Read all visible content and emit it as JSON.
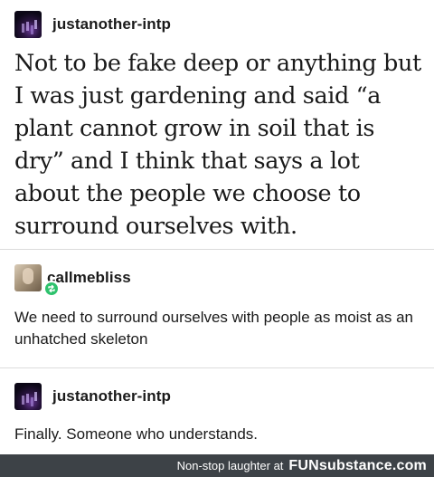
{
  "posts": [
    {
      "username": "justanother-intp",
      "text": "Not to be fake deep or anything but I was just gardening and said “a plant cannot grow in soil that is dry” and I think that says a lot about the people we choose to surround ourselves with."
    },
    {
      "username": "callmebliss",
      "text": "We need to surround ourselves with people as moist as an unhatched skeleton"
    },
    {
      "username": "justanother-intp",
      "text": "Finally. Someone who understands."
    }
  ],
  "footer": {
    "tagline": "Non-stop laughter at",
    "logo": "FUNsubstance.com"
  },
  "colors": {
    "reblog_badge": "#2ec26d",
    "footer_bg": "#3d4247"
  },
  "icons": {
    "reblog": "reblog-icon"
  }
}
